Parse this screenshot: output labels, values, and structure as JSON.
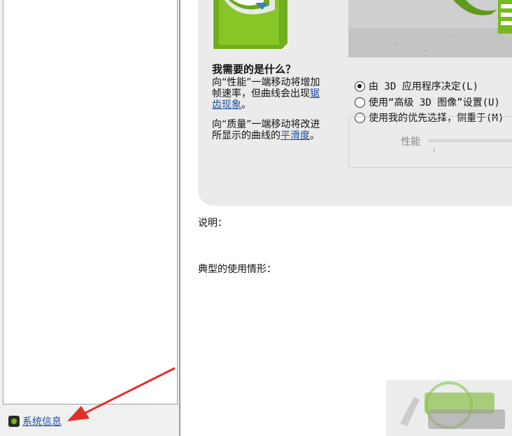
{
  "sidebar": {
    "system_info_label": "系统信息"
  },
  "help": {
    "title": "我需要的是什么？",
    "para1_text": "向“性能”一端移动将增加帧速率，但曲线会出现",
    "para1_link": "锯齿现象",
    "para1_end": "。",
    "para2_text": "向“质量”一端移动将改进所显示的曲线的",
    "para2_link": "平滑度",
    "para2_end": "。"
  },
  "options": {
    "radio1_label": "由 3D 应用程序决定(L)",
    "radio2_label": "使用“高级 3D 图像”设置(U)",
    "radio3_label": "使用我的优先选择，侧重于(M)",
    "selected": 0,
    "slider_left_label": "性能"
  },
  "info": {
    "description_label": "说明：",
    "usage_label": "典型的使用情形："
  },
  "colors": {
    "nvidia_green": "#76b900",
    "link_blue": "#1a4f9e",
    "arrow_red": "#e0302a"
  }
}
